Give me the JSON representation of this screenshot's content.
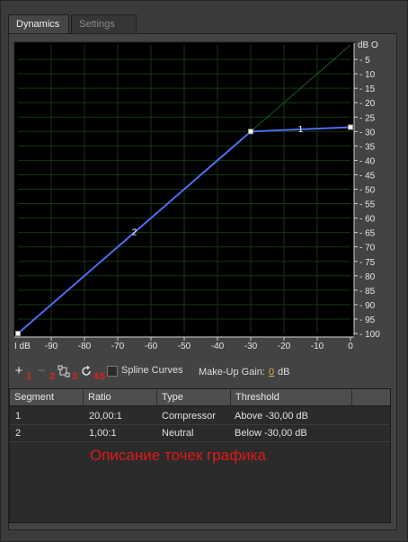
{
  "tabs": [
    {
      "label": "Dynamics",
      "active": true
    },
    {
      "label": "Settings",
      "active": false
    }
  ],
  "graph": {
    "y_unit_label": "dB O",
    "x_axis_first_label": "I dB",
    "y_ticks": [
      {
        "v": -5,
        "label": "- 5"
      },
      {
        "v": -10,
        "label": "- 10"
      },
      {
        "v": -15,
        "label": "- 15"
      },
      {
        "v": -20,
        "label": "- 20"
      },
      {
        "v": -25,
        "label": "- 25"
      },
      {
        "v": -30,
        "label": "- 30"
      },
      {
        "v": -35,
        "label": "- 35"
      },
      {
        "v": -40,
        "label": "- 40"
      },
      {
        "v": -45,
        "label": "- 45"
      },
      {
        "v": -50,
        "label": "- 50"
      },
      {
        "v": -55,
        "label": "- 55"
      },
      {
        "v": -60,
        "label": "- 60"
      },
      {
        "v": -65,
        "label": "- 65"
      },
      {
        "v": -70,
        "label": "- 70"
      },
      {
        "v": -75,
        "label": "- 75"
      },
      {
        "v": -80,
        "label": "- 80"
      },
      {
        "v": -85,
        "label": "- 85"
      },
      {
        "v": -90,
        "label": "- 90"
      },
      {
        "v": -95,
        "label": "- 95"
      },
      {
        "v": -100,
        "label": "- 100"
      }
    ],
    "x_ticks": [
      {
        "v": -90,
        "label": "-90"
      },
      {
        "v": -80,
        "label": "-80"
      },
      {
        "v": -70,
        "label": "-70"
      },
      {
        "v": -60,
        "label": "-60"
      },
      {
        "v": -50,
        "label": "-50"
      },
      {
        "v": -40,
        "label": "-40"
      },
      {
        "v": -30,
        "label": "-30"
      },
      {
        "v": -20,
        "label": "-20"
      },
      {
        "v": -10,
        "label": "-10"
      },
      {
        "v": 0,
        "label": "0"
      }
    ],
    "colors": {
      "background": "#000000",
      "grid": "#123812",
      "curve": "#4f6cf0",
      "diagonal": "#1c5a1c"
    }
  },
  "chart_data": {
    "type": "line",
    "xlim": [
      -100,
      0
    ],
    "ylim": [
      -100,
      0
    ],
    "series": [
      {
        "values": [
          {
            "x": -100,
            "y": -100
          },
          {
            "x": -30,
            "y": -30
          },
          {
            "x": 0,
            "y": -28.5
          }
        ]
      }
    ],
    "points": [
      {
        "x": -100,
        "y": -100
      },
      {
        "x": -30,
        "y": -30
      },
      {
        "x": 0,
        "y": -28.5
      }
    ],
    "segment_labels": [
      {
        "label": "1",
        "x": -15,
        "y": -29.3
      },
      {
        "label": "2",
        "x": -65,
        "y": -65
      }
    ],
    "grid": true
  },
  "toolbar": {
    "add_icon": "plus-icon",
    "remove_icon": "minus-icon",
    "link_icon": "link-nodes-icon",
    "reset_icon": "reset-icon",
    "markers": [
      "1",
      "2",
      "3",
      "4",
      "5"
    ],
    "spline_label": "Spline Curves",
    "spline_checked": false,
    "makeup_label": "Make-Up Gain:",
    "makeup_value": "0",
    "makeup_unit": "dB"
  },
  "table": {
    "headers": [
      "Segment",
      "Ratio",
      "Type",
      "Threshold"
    ],
    "rows": [
      {
        "segment": "1",
        "ratio": "20,00:1",
        "type": "Compressor",
        "threshold": "Above -30,00 dB"
      },
      {
        "segment": "2",
        "ratio": "1,00:1",
        "type": "Neutral",
        "threshold": "Below -30,00 dB"
      }
    ]
  },
  "annotation": "Описание точек графика"
}
